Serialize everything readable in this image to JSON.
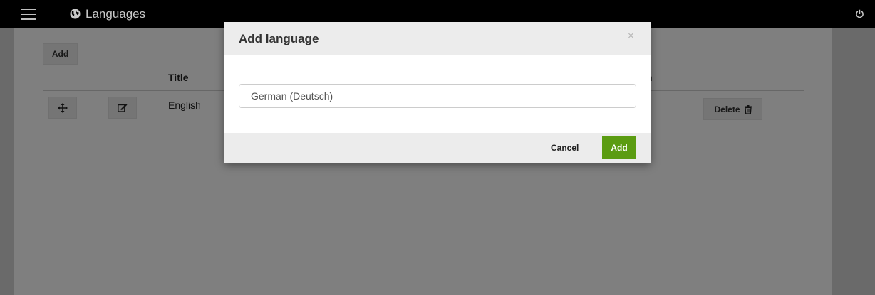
{
  "header": {
    "title": "Languages",
    "menu_icon": "hamburger-menu-icon",
    "title_icon": "globe-icon",
    "power_icon": "power-icon"
  },
  "toolbar": {
    "add_label": "Add"
  },
  "table": {
    "columns": [
      "Title"
    ],
    "rows": [
      {
        "title": "English",
        "move_icon": "move-arrows-icon",
        "edit_icon": "edit-icon",
        "delete_label": "Delete",
        "delete_icon": "trash-icon"
      }
    ]
  },
  "modal": {
    "title": "Add language",
    "close_symbol": "×",
    "input_value": "German (Deutsch)",
    "cancel_label": "Cancel",
    "add_label": "Add"
  },
  "colors": {
    "topbar": "#000000",
    "accent_green": "#5b9c12",
    "overlay": "rgba(0,0,0,0.5)"
  }
}
